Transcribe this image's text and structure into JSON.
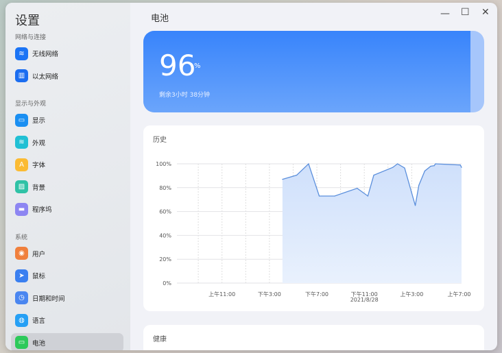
{
  "sidebar": {
    "title": "设置",
    "sections": [
      {
        "label": "网络与连接",
        "items": [
          {
            "label": "无线网络",
            "icon": "wifi-icon",
            "color": "#1b74f5"
          },
          {
            "label": "以太网络",
            "icon": "ethernet-icon",
            "color": "#1b6df0"
          }
        ]
      },
      {
        "label": "显示与外观",
        "items": [
          {
            "label": "显示",
            "icon": "monitor-icon",
            "color": "#1a8ff2"
          },
          {
            "label": "外观",
            "icon": "layers-icon",
            "color": "#21c0d4"
          },
          {
            "label": "字体",
            "icon": "font-icon",
            "color": "#fbbb33"
          },
          {
            "label": "背景",
            "icon": "image-icon",
            "color": "#2fc2a6"
          },
          {
            "label": "程序坞",
            "icon": "dock-icon",
            "color": "#8d86f2"
          }
        ]
      },
      {
        "label": "系统",
        "items": [
          {
            "label": "用户",
            "icon": "user-icon",
            "color": "#f0803d"
          },
          {
            "label": "鼠标",
            "icon": "cursor-icon",
            "color": "#3a7ff0"
          },
          {
            "label": "日期和时间",
            "icon": "clock-icon",
            "color": "#4a86f0"
          },
          {
            "label": "语言",
            "icon": "globe-icon",
            "color": "#26a0f5"
          },
          {
            "label": "电池",
            "icon": "battery-icon",
            "color": "#2dc95a",
            "active": true
          }
        ]
      }
    ]
  },
  "main": {
    "title": "电池",
    "battery": {
      "percent": 96,
      "unit": "%",
      "remaining": "剩余3小时 38分钟"
    },
    "history_title": "历史",
    "health_title": "健康"
  },
  "chart_data": {
    "type": "area",
    "title": "历史",
    "xlabel": "",
    "ylabel": "",
    "ylim": [
      0,
      100
    ],
    "xlim": [
      7.2,
      31.2
    ],
    "yticks": [
      0,
      20,
      40,
      60,
      80,
      100
    ],
    "ytick_labels": [
      "0%",
      "20%",
      "40%",
      "60%",
      "80%",
      "100%"
    ],
    "xticks": [
      11,
      15,
      19,
      23,
      27,
      31
    ],
    "xtick_labels": [
      "上午11:00",
      "下午3:00",
      "下午7:00",
      "下午11:00",
      "上午3:00",
      "上午7:00"
    ],
    "date_label": "2021/8/28",
    "x": [
      16.1,
      17.3,
      18.3,
      19.2,
      20.5,
      22.4,
      23.3,
      23.8,
      25.4,
      25.8,
      26.4,
      27.3,
      27.6,
      28.1,
      28.6,
      28.9,
      29.0,
      31.1,
      31.2
    ],
    "y": [
      87,
      90.5,
      100,
      73,
      73,
      79.5,
      73,
      90.5,
      97,
      100,
      96.5,
      65,
      82,
      94,
      98,
      98.5,
      100,
      99,
      97
    ],
    "color": "#5b8fdc",
    "grid": true
  }
}
